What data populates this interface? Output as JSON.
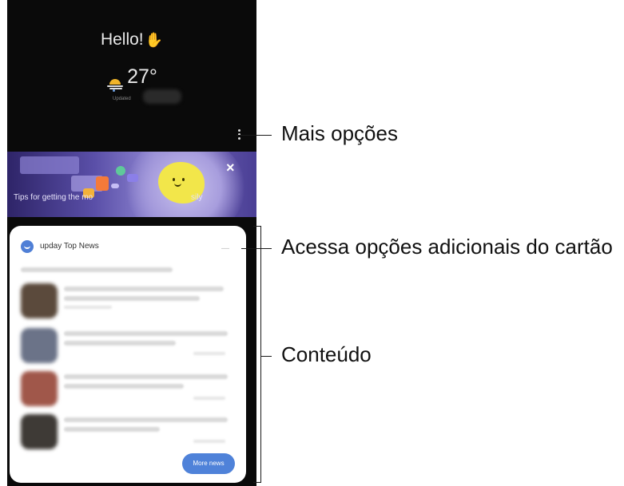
{
  "phone": {
    "greeting": "Hello!",
    "temperature": "27°",
    "location": "",
    "updated_label": "Updated"
  },
  "banner": {
    "tips_text": "Tips for getting the mo",
    "tips_text_end": "sily",
    "close_glyph": "×"
  },
  "card": {
    "title": "upday Top News",
    "menu_glyph": "—",
    "more_button": "More news"
  },
  "callouts": {
    "more_options": "Mais opções",
    "card_options": "Acessa opções adicionais do cartão",
    "content": "Conteúdo"
  },
  "colors": {
    "accent_blue": "#4f82d9",
    "banner_purple": "#5a4fa8",
    "smiley_yellow": "#f2e64a"
  }
}
